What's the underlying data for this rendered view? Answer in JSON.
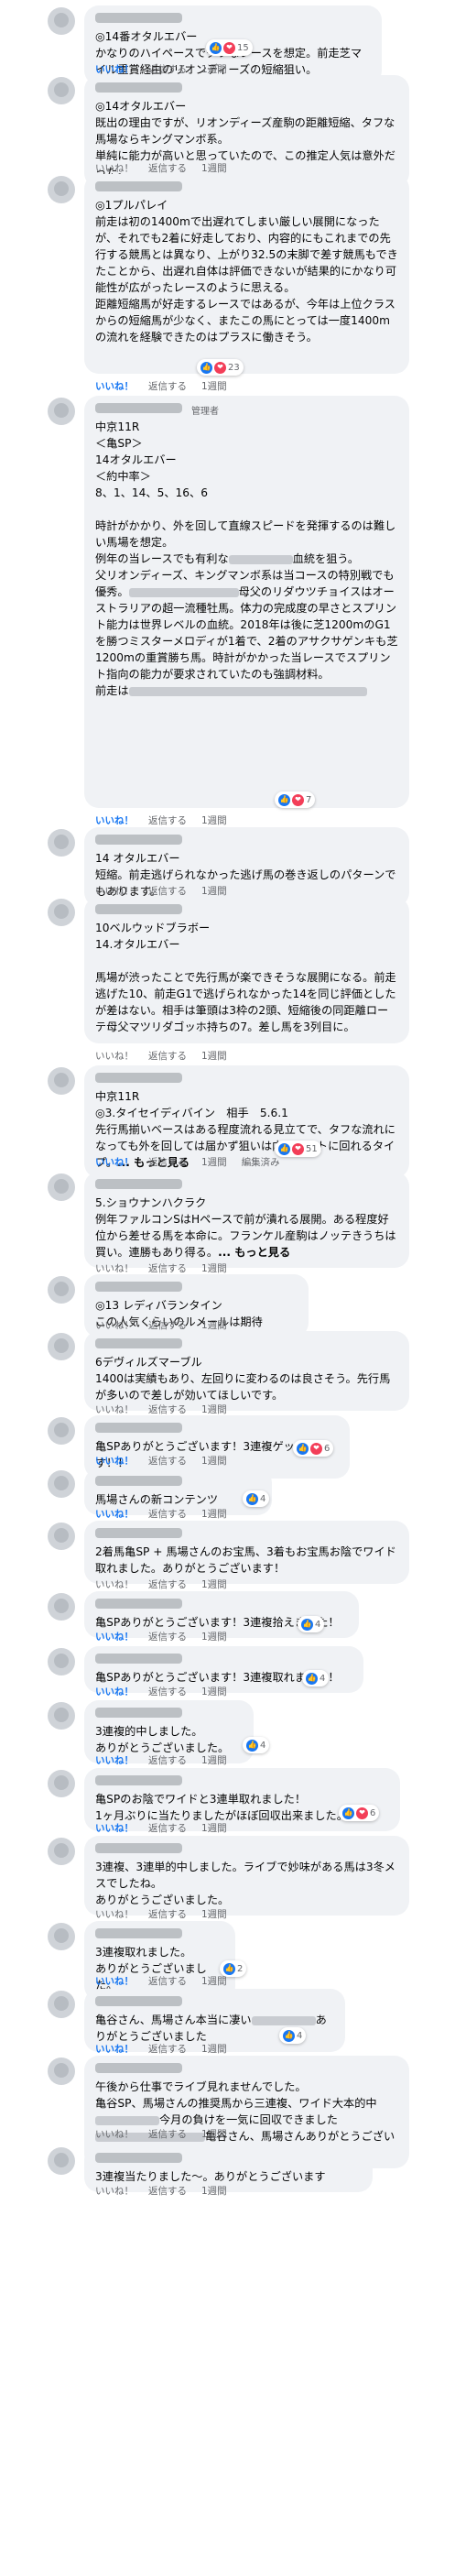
{
  "actions": {
    "like": "いいね！",
    "reply": "返信する",
    "edit": "編集済み"
  },
  "reaction_icons": {
    "like": "like-icon",
    "love": "love-icon",
    "haha": "haha-icon",
    "blue": "#1877f2",
    "red": "#f33e58"
  },
  "comments": [
    {
      "body": "◎14番オタルエバー\nかなりのハイペースでタフなレースを想定。前走芝マイル重賞経由のリオンディーズの短縮狙い。",
      "time": "1週間",
      "reactions": "15"
    },
    {
      "body": "◎14オタルエバー\n既出の理由ですが、リオンディーズ産駒の距離短縮、タフな馬場ならキングマンボ系。\n単純に能力が高いと思っていたので、この推定人気は意外だった。",
      "time": "1週間",
      "reactions": ""
    },
    {
      "body": "◎1プルパレイ\n前走は初の1400mで出遅れてしまい厳しい展開になったが、それでも2着に好走しており、内容的にもこれまでの先行する競馬とは異なり、上がり32.5の末脚で差す競馬もできたことから、出遅れ自体は評価できないが結果的にかなり可能性が広がったレースのように思える。\n距離短縮馬が好走するレースではあるが、今年は上位クラスからの短縮馬が少なく、またこの馬にとっては一度1400mの流れを経験できたのはプラスに働きそう。",
      "time": "1週間",
      "reactions": "23"
    },
    {
      "admin": "管理者",
      "body": "中京11R\n＜亀SP＞\n14オタルエバー\n＜約中率＞\n8、1、14、5、16、6\n\n時計がかかり、外を回して直線スピードを発揮するのは難しい馬場を想定。\n例年の当レースでも有利な",
      "body2": "血統を狙う。\n父リオンディーズ、キングマンボ系は当コースの特別戦でも優秀。",
      "body3": "母父のリダウツチョイスはオーストラリアの超一流種牡馬。体力の完成度の早さとスプリント能力は世界レベルの血統。2018年は後に芝1200mのG1を勝つミスターメロディが1着で、2着のアサクサゲンキも芝1200mの重賞勝ち馬。時計がかかった当レースでスプリント指向の能力が要求されていたのも強調材料。\n前走は",
      "time": "1週間",
      "reactions": "7"
    },
    {
      "body": "14 オタルエバー\n短縮。前走逃げられなかった逃げ馬の巻き返しのパターンでもあります。",
      "time": "1週間",
      "reactions": ""
    },
    {
      "body": "10ベルウッドブラボー\n14.オタルエバー\n\n馬場が渋ったことで先行馬が楽できそうな展開になる。前走逃げた10、前走G1で逃げられなかった14を同じ評価としたが差はない。相手は筆頭は3枠の2頭、短縮後の同距離ローテ母父マツリダゴッホ持ちの7。差し馬を3列目に。",
      "time": "1週間",
      "reactions": ""
    },
    {
      "body": "中京11R\n◎3.タイセイディバイン　相手　5.6.1\n先行馬揃いベースはある程度流れる見立てで、タフな流れになっても外を回しては届かず狙いは内をタイトに回れるタイプ。",
      "more": "... もっと見る",
      "time": "1週間",
      "reactions": "51"
    },
    {
      "body": "5.ショウナンハクラク\n例年ファルコンSはHペースで前が潰れる展開。ある程度好位から差せる馬を本命に。フランケル産駒はノッテきうちは買い。連勝もあり得る。",
      "more": "... もっと見る",
      "time": "1週間",
      "reactions": ""
    },
    {
      "body": "◎13 レディバランタイン\nこの人気くらいのルメールは期待",
      "time": "1週間",
      "reactions": ""
    },
    {
      "body": "6デヴィルズマーブル\n1400は実績もあり、左回りに変わるのは良さそう。先行馬が多いので差しが効いてほしいです。",
      "time": "1週間",
      "reactions": ""
    },
    {
      "body": "亀SPありがとうございます！3連複ゲットです！！",
      "time": "1週間",
      "reactions": "6"
    },
    {
      "body": "馬場さんの新コンテンツ",
      "time": "1週間",
      "reactions": "4"
    },
    {
      "body": "2着馬亀SP + 馬場さんのお宝馬、3着もお宝馬お陰でワイド取れました。ありがとうございます！",
      "time": "1週間",
      "reactions": ""
    },
    {
      "body": "亀SPありがとうございます！3連複拾えました！",
      "time": "1週間",
      "reactions": "4"
    },
    {
      "body": "亀SPありがとうございます！3連複取れました！",
      "time": "1週間",
      "reactions": "4"
    },
    {
      "body": "3連複的中しました。\nありがとうございました。",
      "time": "1週間",
      "reactions": "4"
    },
    {
      "body": "亀SPのお陰でワイドと3連単取れました！\n1ヶ月ぶりに当たりましたがほぼ回収出来ました。",
      "time": "1週間",
      "reactions": "6"
    },
    {
      "body": "3連複、3連単的中しました。ライブで妙味がある馬は3冬メスでしたね。\nありがとうございました。",
      "time": "1週間",
      "reactions": ""
    },
    {
      "body": "3連複取れました。\nありがとうございました。",
      "time": "1週間",
      "reactions": "2"
    },
    {
      "body": "亀谷さん、馬場さん本当に凄い",
      "body2": "ありがとうございました",
      "time": "1週間",
      "reactions": "4"
    },
    {
      "body": "午後から仕事でライブ見れませんでした。\n亀谷SP、馬場さんの推奨馬から三連複、ワイド大本的中",
      "body2": "今月の負けを一気に回収できました",
      "body3": "亀谷さん、馬場さんありがとうございます。",
      "time": "1週間",
      "reactions": ""
    },
    {
      "body": "3連複当たりました〜。ありがとうございます",
      "time": "1週間",
      "reactions": ""
    }
  ]
}
